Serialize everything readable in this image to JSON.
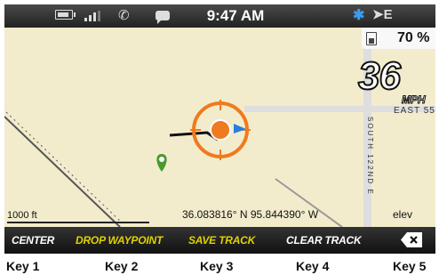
{
  "status_bar": {
    "time": "9:47 AM",
    "icons": [
      "battery-icon",
      "signal-icon",
      "phone-icon",
      "chat-icon",
      "bluetooth-icon",
      "data-e-icon"
    ],
    "data_indicator": "➤E",
    "bluetooth_glyph": "✱",
    "phone_glyph": "✆",
    "bluetooth_color": "#3a9cf0"
  },
  "map": {
    "battery_percent": "70 %",
    "speed": "36",
    "speed_unit": "MPH",
    "street_east": "EAST 55",
    "street_south": "SOUTH 122ND E",
    "scale": "1000 ft",
    "coordinates": "36.083816° N 95.844390° W",
    "elevation_label": "elev",
    "background_color": "#f2eccd",
    "position_marker_color": "#f07a1e",
    "waypoint_color": "#4a9a2e"
  },
  "softkeys": [
    {
      "label": "CENTER",
      "color": "#ffffff"
    },
    {
      "label": "DROP WAYPOINT",
      "color": "#e0d200"
    },
    {
      "label": "SAVE TRACK",
      "color": "#e0d200"
    },
    {
      "label": "CLEAR TRACK",
      "color": "#ffffff"
    },
    {
      "label": "",
      "icon": "backspace-icon"
    }
  ],
  "key_labels": [
    "Key 1",
    "Key 2",
    "Key 3",
    "Key 4",
    "Key 5"
  ]
}
